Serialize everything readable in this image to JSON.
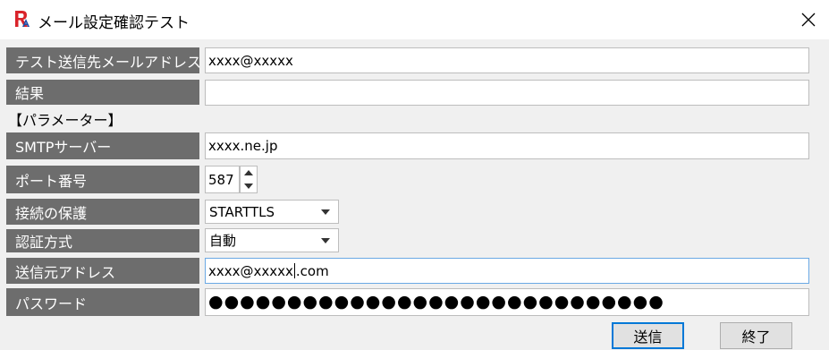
{
  "window": {
    "title": "メール設定確認テスト",
    "app_icon_text": "RA",
    "close_icon": "close-icon"
  },
  "form": {
    "test_address_label": "テスト送信先メールアドレス",
    "test_address_value": "xxxx@xxxxx",
    "result_label": "結果",
    "result_value": "",
    "parameters_heading": "【パラメーター】",
    "smtp_label": "SMTPサーバー",
    "smtp_value": "xxxx.ne.jp",
    "port_label": "ポート番号",
    "port_value": "587",
    "security_label": "接続の保護",
    "security_value": "STARTTLS",
    "auth_label": "認証方式",
    "auth_value": "自動",
    "from_label": "送信元アドレス",
    "from_value_before_caret": "xxxx@xxxxx",
    "from_value_after_caret": ".com",
    "password_label": "パスワード",
    "password_value": "●●●●●●●●●●●●●●●●●●●●●●●●●●●●●"
  },
  "buttons": {
    "send_label": "送信",
    "exit_label": "終了"
  },
  "colors": {
    "label_bg": "#6d6d6d",
    "focus_border": "#6aa9e4",
    "logo_red": "#d9232a"
  }
}
